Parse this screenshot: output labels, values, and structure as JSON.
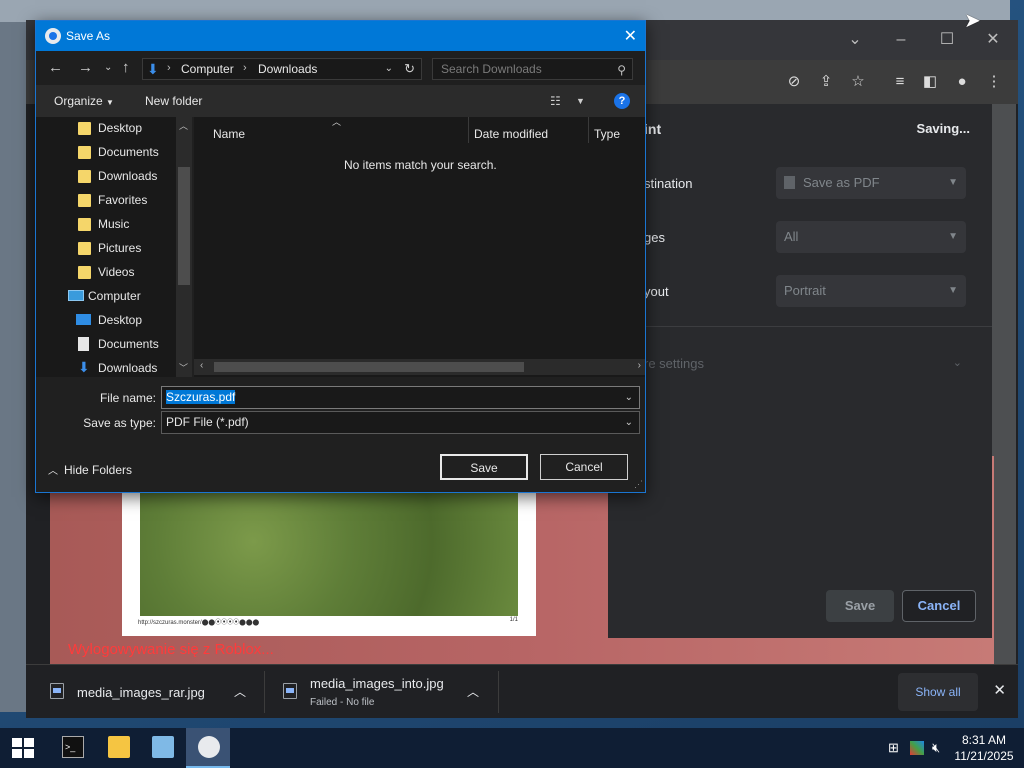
{
  "save_dialog": {
    "title": "Save As",
    "breadcrumb": [
      "Computer",
      "Downloads"
    ],
    "search_placeholder": "Search Downloads",
    "commands": {
      "organize": "Organize",
      "new_folder": "New folder"
    },
    "nav_items": [
      {
        "label": "Desktop",
        "icon": "folder-icon"
      },
      {
        "label": "Documents",
        "icon": "folder-icon"
      },
      {
        "label": "Downloads",
        "icon": "folder-icon"
      },
      {
        "label": "Favorites",
        "icon": "folder-icon"
      },
      {
        "label": "Music",
        "icon": "folder-icon"
      },
      {
        "label": "Pictures",
        "icon": "folder-icon"
      },
      {
        "label": "Videos",
        "icon": "folder-icon"
      },
      {
        "label": "Computer",
        "icon": "computer-icon"
      },
      {
        "label": "Desktop",
        "icon": "desktop-icon"
      },
      {
        "label": "Documents",
        "icon": "documents-icon"
      },
      {
        "label": "Downloads",
        "icon": "downloads-icon"
      }
    ],
    "columns": [
      "Name",
      "Date modified",
      "Type"
    ],
    "empty_message": "No items match your search.",
    "file_name_label": "File name:",
    "file_name_value": "Szczuras.pdf",
    "save_type_label": "Save as type:",
    "save_type_value": "PDF File (*.pdf)",
    "hide_folders": "Hide Folders",
    "save_button": "Save",
    "cancel_button": "Cancel"
  },
  "print_panel": {
    "title": "int",
    "status": "Saving...",
    "destination_label": "stination",
    "destination_value": "Save as PDF",
    "pages_label": "ges",
    "pages_value": "All",
    "layout_label": "yout",
    "layout_value": "Portrait",
    "more_settings": "re settings",
    "save_button": "Save",
    "cancel_button": "Cancel"
  },
  "page_preview": {
    "footer_url": "http://szczuras.monster/⬤⬤⦿⦿⦿⦿⬤⬤⬤",
    "footer_page": "1/1",
    "overlay_text": "Wylogowywanie się z Roblox..."
  },
  "downloads_bar": {
    "items": [
      {
        "name": "media_images_rar.jpg",
        "status": ""
      },
      {
        "name": "media_images_into.jpg",
        "status": "Failed - No file"
      }
    ],
    "show_all": "Show all"
  },
  "taskbar": {
    "time": "8:31 AM",
    "date": "11/21/2025"
  },
  "colors": {
    "dialog_title": "#0078d7",
    "chrome_accent": "#8ab4f8",
    "dialog_bg": "#202020"
  }
}
